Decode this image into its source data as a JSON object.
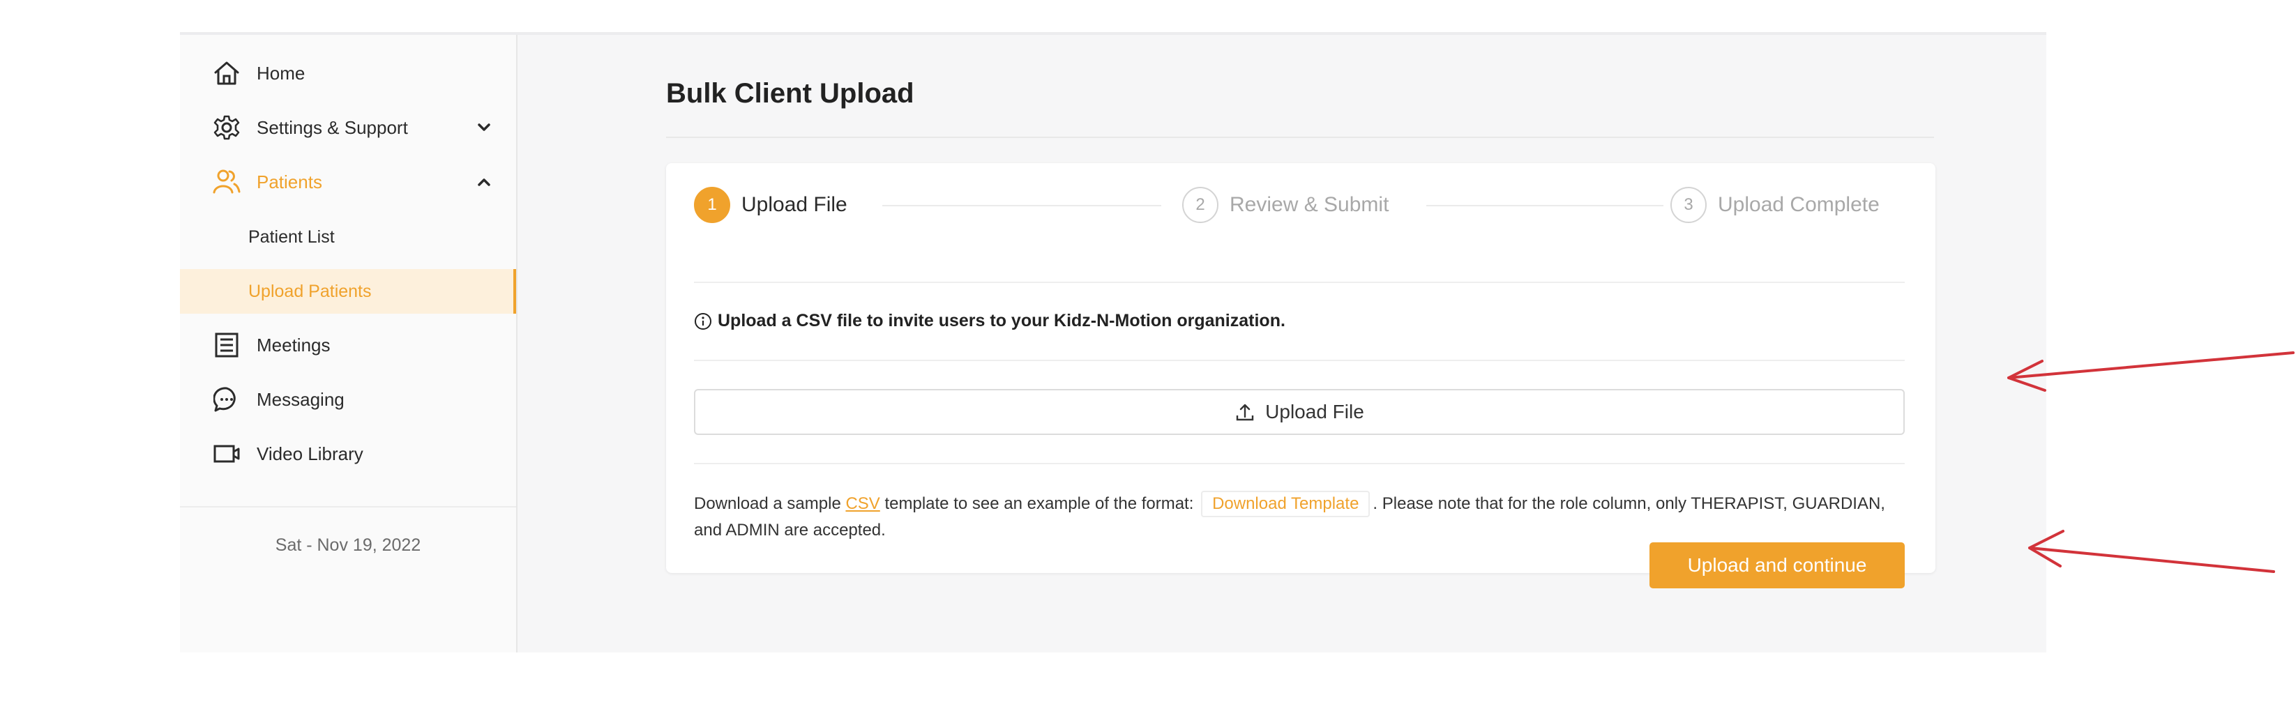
{
  "sidebar": {
    "items": [
      {
        "label": "Home",
        "icon": "home-icon"
      },
      {
        "label": "Settings & Support",
        "icon": "gear-icon"
      },
      {
        "label": "Patients",
        "icon": "users-icon"
      },
      {
        "label": "Meetings",
        "icon": "meetings-icon"
      },
      {
        "label": "Messaging",
        "icon": "chat-bubble-icon"
      },
      {
        "label": "Video Library",
        "icon": "video-icon"
      }
    ],
    "sub_items": [
      {
        "label": "Patient List"
      },
      {
        "label": "Upload Patients"
      }
    ],
    "date": "Sat - Nov 19, 2022"
  },
  "main": {
    "title": "Bulk Client Upload",
    "steps": [
      {
        "number": "1",
        "label": "Upload File"
      },
      {
        "number": "2",
        "label": "Review & Submit"
      },
      {
        "number": "3",
        "label": "Upload Complete"
      }
    ],
    "info_text": "Upload a CSV file to invite users to your Kidz-N-Motion organization.",
    "upload_button": "Upload File",
    "sample": {
      "prefix": "Download a sample ",
      "csv_link": "CSV",
      "middle": " template to see an example of the format: ",
      "download_template": "Download Template",
      "suffix": ". Please note that for the role column, only THERAPIST, GUARDIAN, and ADMIN are accepted."
    },
    "continue_button": "Upload and continue"
  },
  "colors": {
    "accent": "#f0a22c",
    "annotation_arrow": "#d2333a"
  }
}
